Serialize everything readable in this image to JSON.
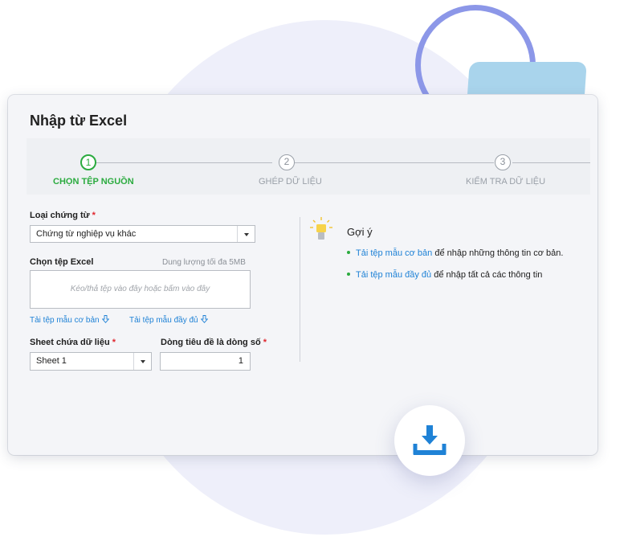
{
  "dialog": {
    "title": "Nhập từ Excel"
  },
  "stepper": {
    "steps": [
      {
        "number": "1",
        "label": "Chọn tệp nguồn",
        "active": true
      },
      {
        "number": "2",
        "label": "Ghép dữ liệu",
        "active": false
      },
      {
        "number": "3",
        "label": "Kiểm tra dữ liệu",
        "active": false
      }
    ]
  },
  "form": {
    "voucher_type": {
      "label": "Loại chứng từ",
      "required_mark": "*",
      "value": "Chứng từ nghiệp vụ khác"
    },
    "file": {
      "label": "Chọn tệp Excel",
      "size_note": "Dung lượng tối đa 5MB",
      "dropzone_placeholder": "Kéo/thả tệp vào đây hoặc bấm vào đây"
    },
    "template_links": {
      "basic": "Tải tệp mẫu cơ bản",
      "full": "Tải tệp mẫu đầy đủ"
    },
    "sheet": {
      "label": "Sheet chứa dữ liệu",
      "required_mark": "*",
      "value": "Sheet 1"
    },
    "header_row": {
      "label": "Dòng tiêu đề là dòng số",
      "required_mark": "*",
      "value": "1"
    }
  },
  "hint": {
    "title": "Gợi ý",
    "items": [
      {
        "link": "Tải tệp mẫu cơ bản",
        "text": " để nhập những thông tin cơ bản."
      },
      {
        "link": "Tải tệp mẫu đầy đủ",
        "text": " để nhập tất cả các thông tin"
      }
    ]
  },
  "colors": {
    "accent_green": "#2bab3f",
    "link_blue": "#1f82d6",
    "required_red": "#e0262e",
    "download_blue": "#1f82d6"
  },
  "icons": {
    "hint": "lightbulb-icon",
    "download": "download-icon",
    "link_arrow": "arrow-down-icon",
    "dropdown": "chevron-down-icon"
  }
}
